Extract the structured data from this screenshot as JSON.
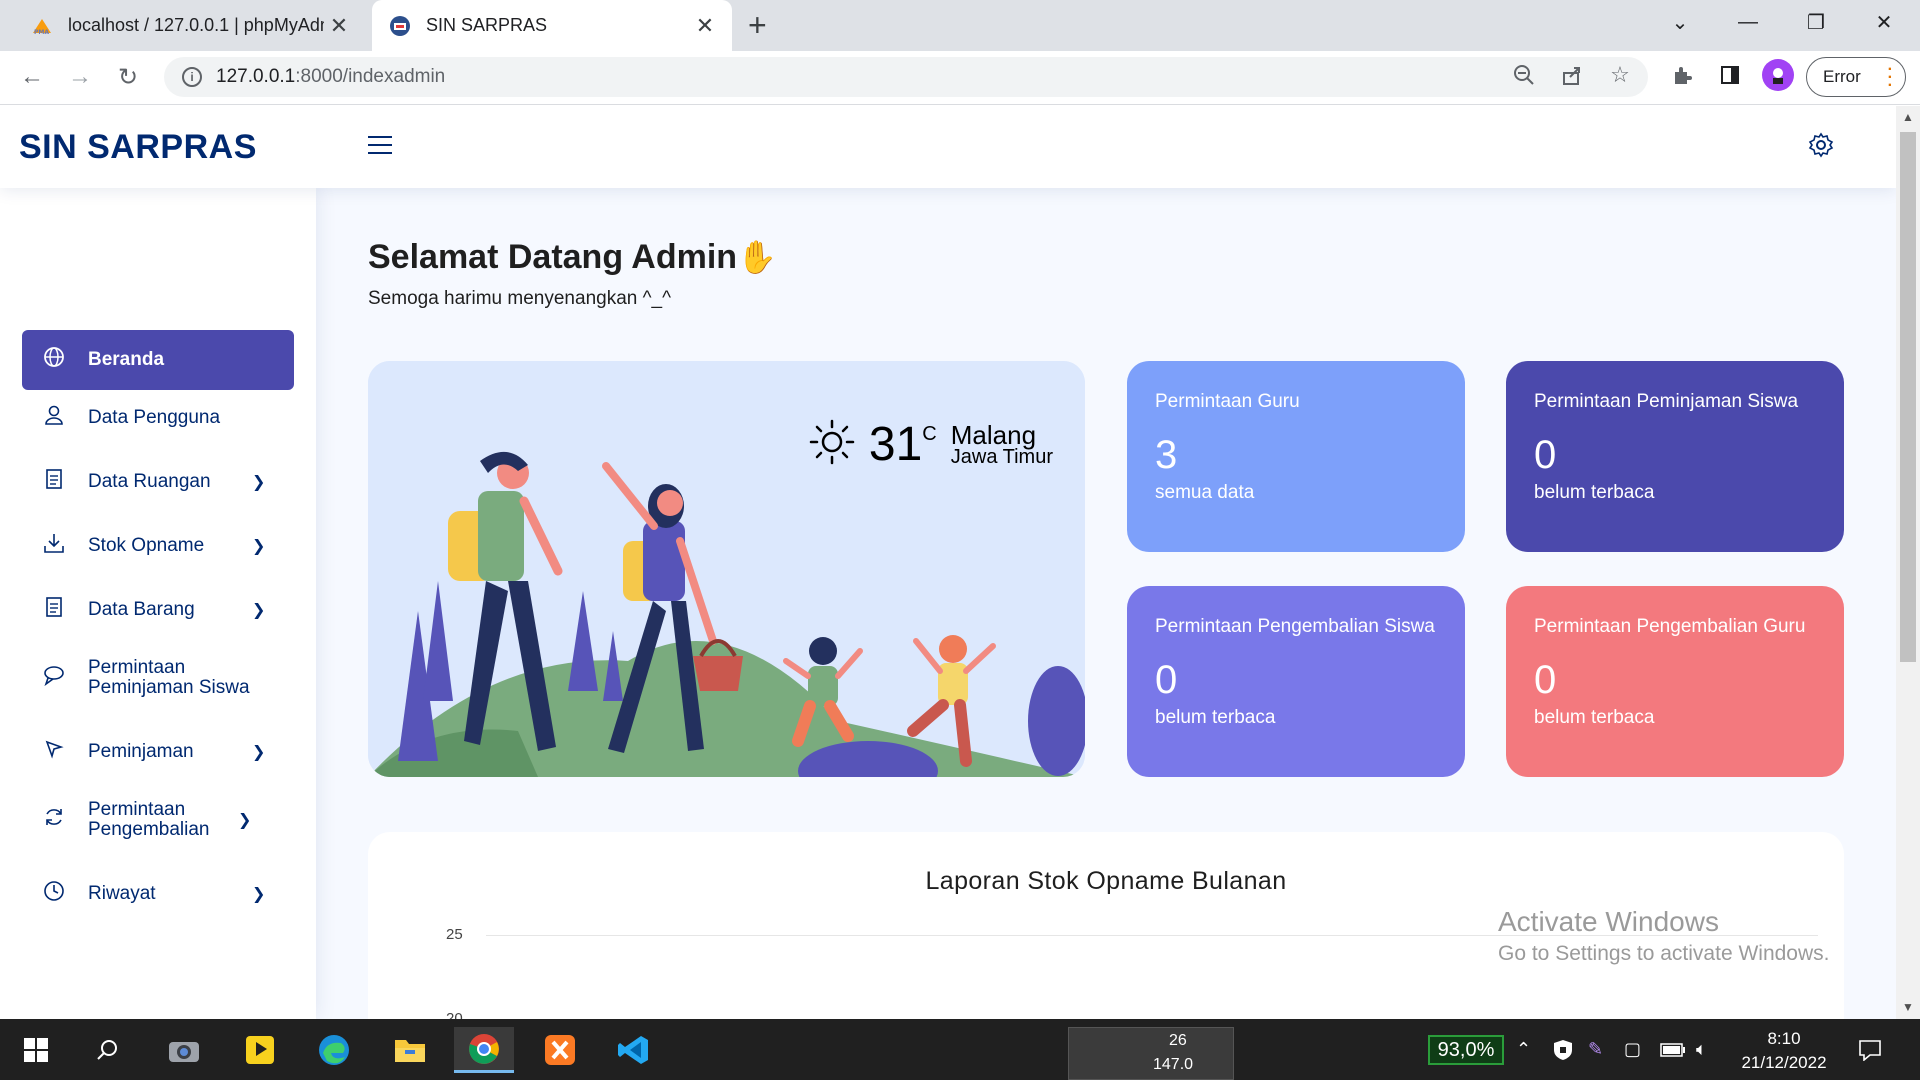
{
  "browser": {
    "tabs": [
      {
        "title": "localhost / 127.0.0.1 | phpMyAdm",
        "icon": "phpmyadmin-icon"
      },
      {
        "title": "SIN SARPRAS",
        "icon": "site-icon"
      }
    ],
    "url_host": "127.0.0.1",
    "url_rest": ":8000/indexadmin",
    "profile_button": "Error"
  },
  "app": {
    "logo": "SIN SARPRAS"
  },
  "sidebar": {
    "items": [
      {
        "label": "Beranda",
        "icon": "globe-icon",
        "active": true,
        "chevron": false
      },
      {
        "label": "Data Pengguna",
        "icon": "user-icon",
        "chevron": false
      },
      {
        "label": "Data Ruangan",
        "icon": "document-icon",
        "chevron": true
      },
      {
        "label": "Stok Opname",
        "icon": "download-icon",
        "chevron": true
      },
      {
        "label": "Data Barang",
        "icon": "document-icon",
        "chevron": true
      },
      {
        "label": "Permintaan Peminjaman Siswa",
        "icon": "chat-icon",
        "chevron": false
      },
      {
        "label": "Peminjaman",
        "icon": "cursor-icon",
        "chevron": true
      },
      {
        "label": "Permintaan Pengembalian",
        "icon": "refresh-icon",
        "chevron": true
      },
      {
        "label": "Riwayat",
        "icon": "clock-icon",
        "chevron": true
      }
    ]
  },
  "main": {
    "welcome": "Selamat Datang Admin",
    "subtitle": "Semoga harimu menyenangkan ^_^",
    "weather": {
      "temp": "31",
      "unit": "C",
      "city": "Malang",
      "region": "Jawa Timur"
    },
    "stats": [
      {
        "title": "Permintaan Guru",
        "value": "3",
        "sub": "semua data",
        "color": "#7da0fa"
      },
      {
        "title": "Permintaan Peminjaman Siswa",
        "value": "0",
        "sub": "belum terbaca",
        "color": "#4b49ac"
      },
      {
        "title": "Permintaan Pengembalian Siswa",
        "value": "0",
        "sub": "belum terbaca",
        "color": "#7978e9"
      },
      {
        "title": "Permintaan Pengembalian Guru",
        "value": "0",
        "sub": "belum terbaca",
        "color": "#f3797e"
      }
    ],
    "chart_title": "Laporan Stok Opname Bulanan"
  },
  "chart_data": {
    "type": "bar",
    "title": "Laporan Stok Opname Bulanan",
    "y_ticks_visible": [
      "25",
      "20"
    ]
  },
  "watermark": {
    "line1": "Activate Windows",
    "line2": "Go to Settings to activate Windows."
  },
  "taskbar": {
    "widget_values": [
      "26",
      "147.0"
    ],
    "battery": "93,0%",
    "time": "8:10",
    "date": "21/12/2022"
  }
}
